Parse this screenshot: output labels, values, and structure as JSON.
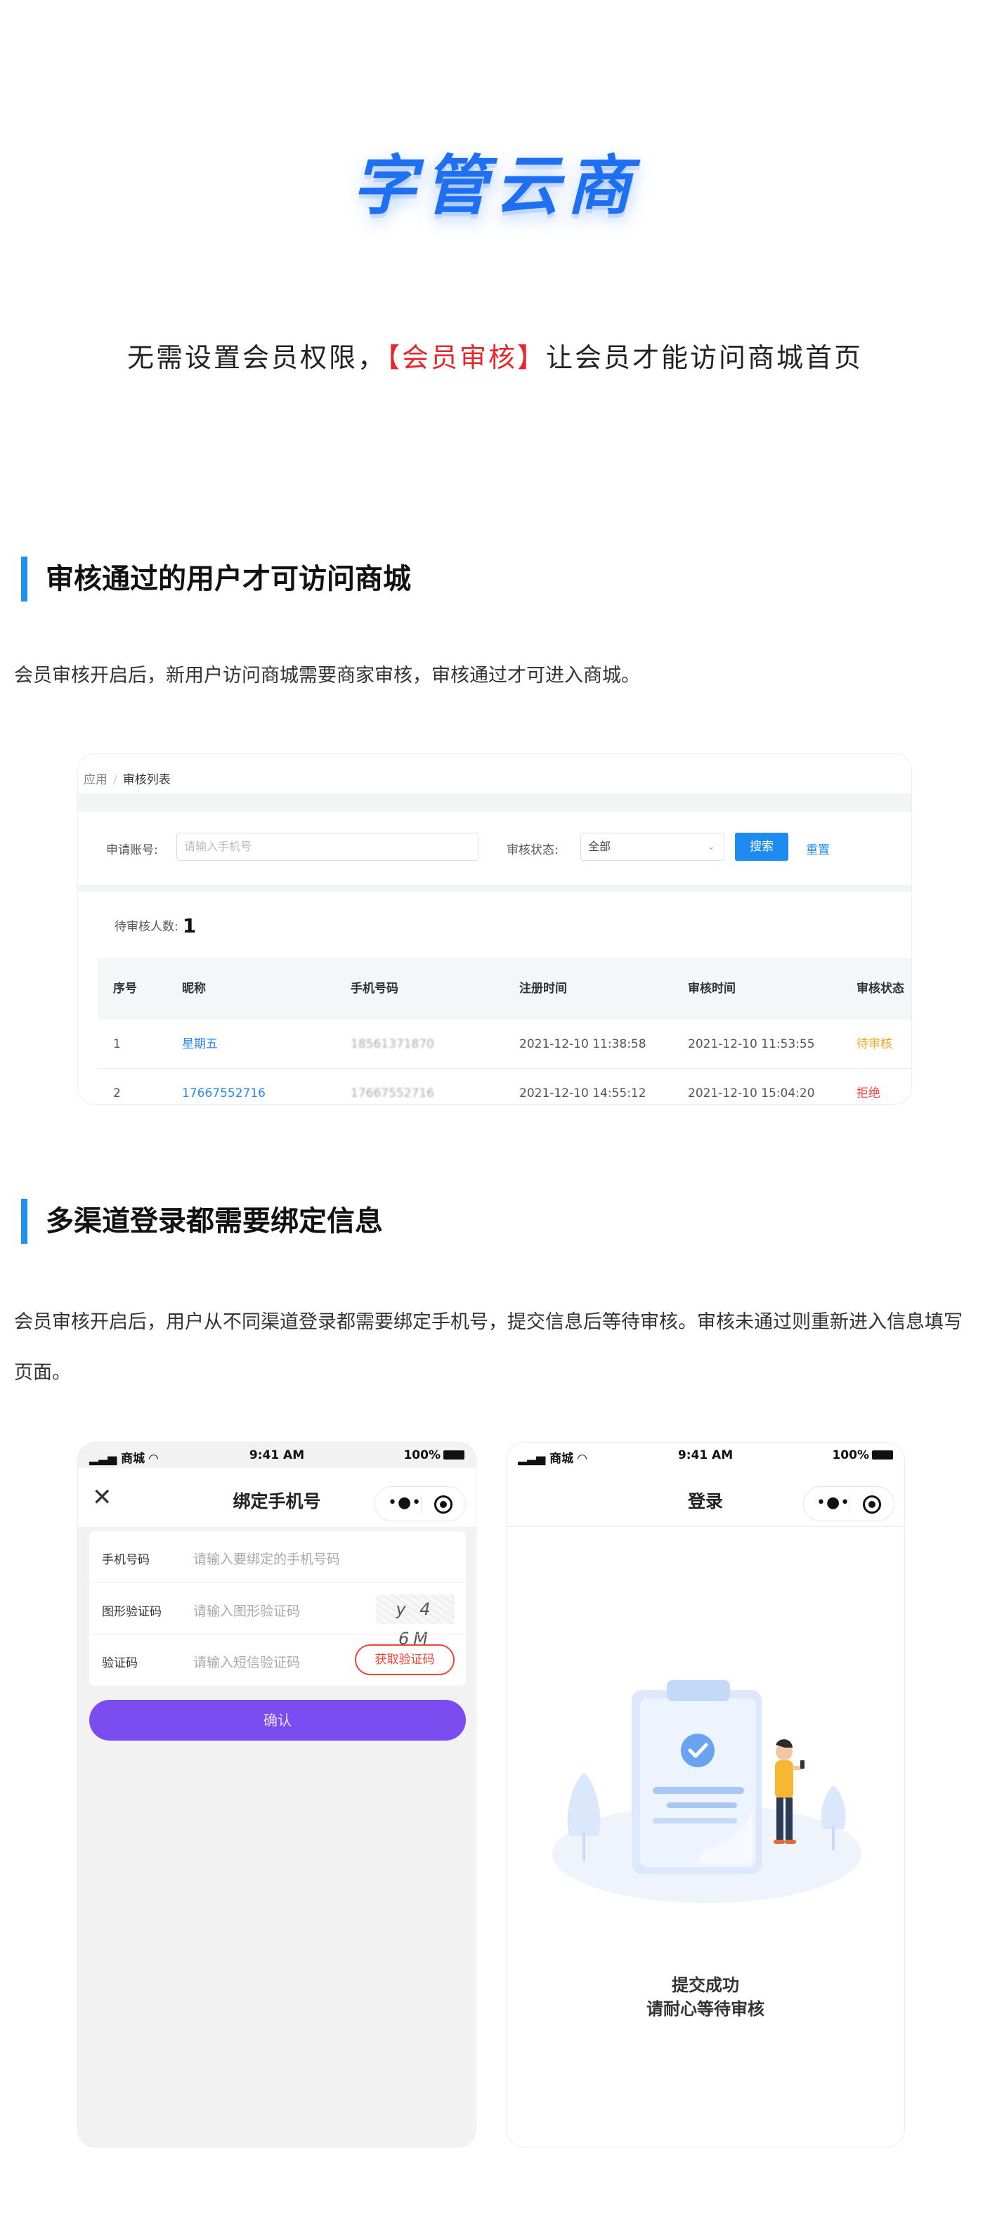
{
  "header": {
    "brand": "字管云商",
    "tagline_prefix": "无需设置会员权限，",
    "tagline_highlight": "【会员审核】",
    "tagline_suffix": "让会员才能访问商城首页"
  },
  "section1": {
    "title": "审核通过的用户才可访问商城",
    "desc": "会员审核开启后，新用户访问商城需要商家审核，审核通过才可进入商城。"
  },
  "admin": {
    "breadcrumb": [
      "应用",
      "审核列表"
    ],
    "breadcrumb_sep": "/",
    "filter": {
      "account_label": "申请账号:",
      "account_placeholder": "请输入手机号",
      "status_label": "审核状态:",
      "status_value": "全部",
      "search_button": "搜索",
      "reset_link": "重置"
    },
    "pending_label": "待审核人数:",
    "pending_count": "1",
    "table": {
      "columns": [
        "序号",
        "昵称",
        "手机号码",
        "注册时间",
        "审核时间",
        "审核状态"
      ],
      "rows": [
        {
          "index": "1",
          "nickname": "星期五",
          "phone": "18561371870",
          "registered": "2021-12-10 11:38:58",
          "reviewed": "2021-12-10 11:53:55",
          "status": "待审核"
        },
        {
          "index": "2",
          "nickname": "17667552716",
          "phone": "17667552716",
          "registered": "2021-12-10 14:55:12",
          "reviewed": "2021-12-10 15:04:20",
          "status": "拒绝"
        }
      ]
    },
    "colors": {
      "pending": "#f5a623",
      "reject": "#f04438",
      "link": "#2a86f5"
    }
  },
  "section2": {
    "title": "多渠道登录都需要绑定信息",
    "desc": "会员审核开启后，用户从不同渠道登录都需要绑定手机号，提交信息后等待审核。审核未通过则重新进入信息填写页面。"
  },
  "phone_left": {
    "status": {
      "carrier": "商城",
      "time": "9:41 AM",
      "battery": "100%"
    },
    "title": "绑定手机号",
    "close_icon": "close-icon",
    "fields": [
      {
        "label": "手机号码",
        "placeholder": "请输入要绑定的手机号码"
      },
      {
        "label": "图形验证码",
        "placeholder": "请输入图形验证码",
        "captcha": "y 4 6M"
      },
      {
        "label": "验证码",
        "placeholder": "请输入短信验证码",
        "button": "获取验证码"
      }
    ],
    "confirm": "确认",
    "accent": "#7b4df0"
  },
  "phone_right": {
    "status": {
      "carrier": "商城",
      "time": "9:41 AM",
      "battery": "100%"
    },
    "title": "登录",
    "success_line1": "提交成功",
    "success_line2": "请耐心等待审核"
  }
}
